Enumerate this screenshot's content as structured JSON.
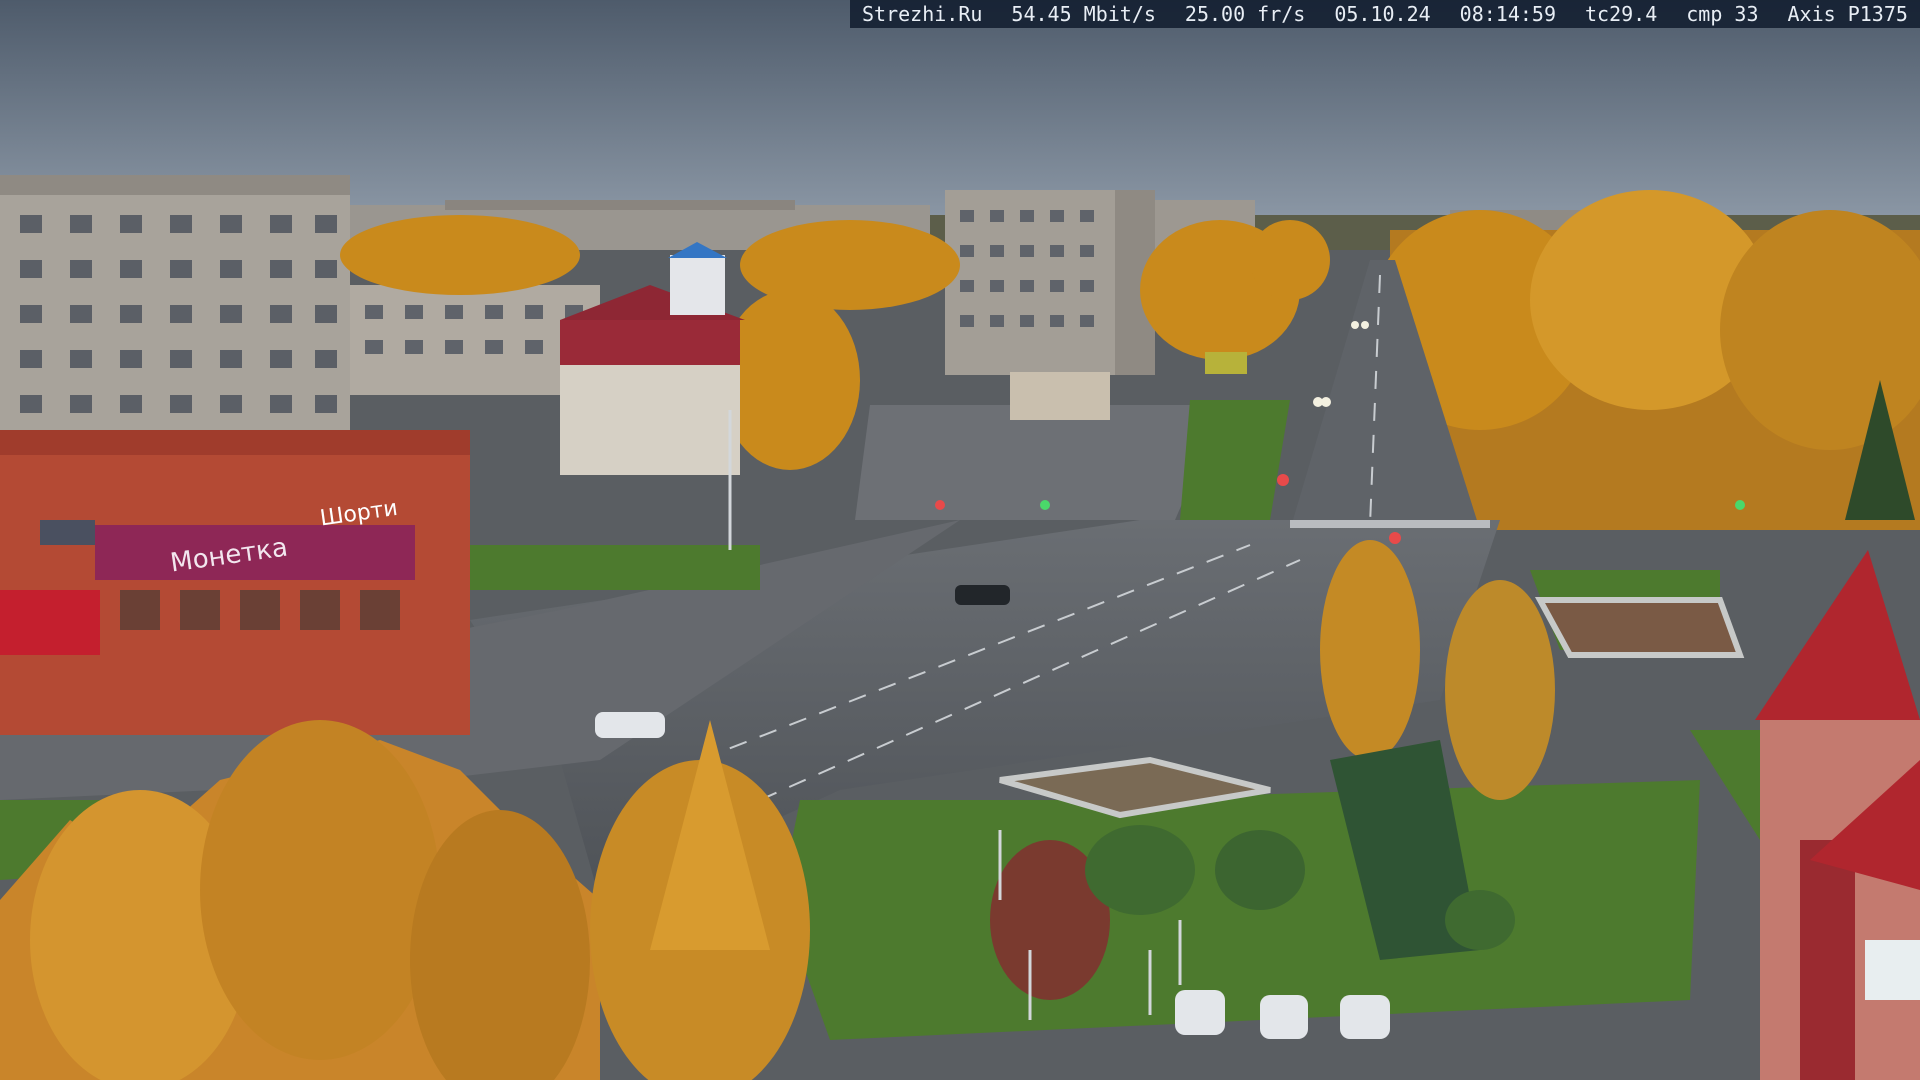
{
  "camera_overlay": {
    "site": "Strezhi.Ru",
    "bitrate": "54.45 Mbit/s",
    "framerate": "25.00 fr/s",
    "date": "05.10.24",
    "time": "08:14:59",
    "tc": "tc29.4",
    "cmp": "cmp 33",
    "model": "Axis P1375"
  },
  "signage": {
    "store_sign": "Монетка",
    "store_sign_2": "Шорти"
  },
  "colors": {
    "sky_top": "#4e5b6b",
    "sky_horizon": "#8e9aa8",
    "foliage": "#c98a1c",
    "road": "#55595f",
    "grass": "#4d7a2e",
    "store_facade": "#b44a34",
    "roof_red": "#b0262e"
  }
}
